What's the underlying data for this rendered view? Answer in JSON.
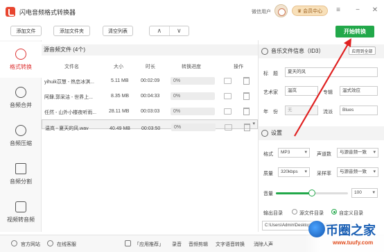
{
  "app": {
    "title": "闪电音频格式转换器"
  },
  "header": {
    "user_text": "微信用户",
    "vip_label": "会员中心"
  },
  "toolbar": {
    "add_file": "添加文件",
    "add_folder": "添加文件夹",
    "clear_list": "清空列表",
    "up": "∧",
    "down": "∨",
    "start": "开始转换"
  },
  "sidebar": {
    "items": [
      {
        "label": "格式转换",
        "active": true
      },
      {
        "label": "音频合并"
      },
      {
        "label": "音频压缩"
      },
      {
        "label": "音频分割"
      },
      {
        "label": "视频转音频"
      }
    ]
  },
  "file_list": {
    "header": "源音频文件 (4个)",
    "columns": [
      "文件名",
      "大小",
      "时长",
      "转换进度",
      "操作"
    ],
    "rows": [
      {
        "name": "yihuik苡慧 - 热恋冰淇...",
        "size": "5.11 MB",
        "duration": "00:02:09",
        "progress": "0%"
      },
      {
        "name": "阿肆,郭采洁 - 世界上...",
        "size": "8.35 MB",
        "duration": "00:04:33",
        "progress": "0%"
      },
      {
        "name": "任然 - 山外小楼夜听雨...",
        "size": "28.11 MB",
        "duration": "00:03:03",
        "progress": "0%"
      },
      {
        "name": "温岚 - 夏天的风.wav",
        "size": "40.49 MB",
        "duration": "00:03:50",
        "progress": "0%"
      }
    ]
  },
  "id3": {
    "title": "音乐文件信息（ID3）",
    "apply_all": "应用到全部",
    "title_label": "标　题",
    "title_value": "夏天的风",
    "artist_label": "艺术家",
    "artist_value": "温岚",
    "album_label": "专辑",
    "album_value": "温式效应",
    "year_label": "年　份",
    "year_value": "无",
    "genre_label": "流派",
    "genre_value": "Blues"
  },
  "settings": {
    "title": "设置",
    "format_label": "格式",
    "format_value": "MP3",
    "channel_label": "声道数",
    "channel_value": "与源音频一致",
    "quality_label": "质量",
    "quality_value": "320kbps",
    "samplerate_label": "采样率",
    "samplerate_value": "与源音频一致",
    "volume_label": "音量",
    "volume_value": "100",
    "volume_level_pct": 50,
    "output_label": "输出目录",
    "source_dir_label": "源文件目录",
    "custom_dir_label": "自定义目录",
    "output_path": "C:\\Users\\Admin\\Desktop\\闪电音频格式..."
  },
  "bottombar": {
    "website": "官方网站",
    "feedback": "在线客服",
    "recommend": "「应用推荐」",
    "links": [
      "录音",
      "音频剪辑",
      "文字语音转换",
      "消除人声"
    ]
  },
  "watermark": {
    "title": "币圈之家",
    "url": "www.tuufy.com"
  },
  "colors": {
    "accent": "#22a84a",
    "active": "#dd3333",
    "arrow": "#e02020"
  }
}
